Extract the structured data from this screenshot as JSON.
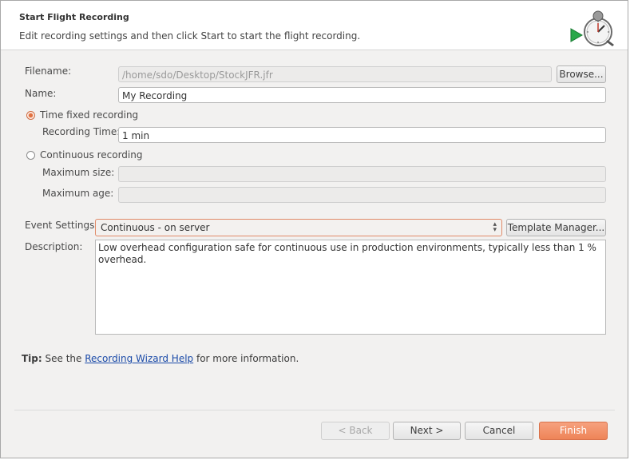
{
  "header": {
    "title": "Start Flight Recording",
    "subtitle": "Edit recording settings and then click Start to start the flight recording."
  },
  "form": {
    "filename_label": "Filename:",
    "filename_value": "/home/sdo/Desktop/StockJFR.jfr",
    "browse_label": "Browse...",
    "name_label": "Name:",
    "name_value": "My Recording",
    "time_fixed_label": "Time fixed recording",
    "time_fixed_checked": true,
    "recording_time_label": "Recording Time:",
    "recording_time_value": "1 min",
    "continuous_label": "Continuous recording",
    "continuous_checked": false,
    "max_size_label": "Maximum size:",
    "max_size_value": "",
    "max_age_label": "Maximum age:",
    "max_age_value": "",
    "event_settings_label": "Event Settings:",
    "event_settings_value": "Continuous - on server",
    "template_manager_label": "Template Manager...",
    "description_label": "Description:",
    "description_value": "Low overhead configuration safe for continuous use in production environments, typically less than 1 % overhead."
  },
  "tip": {
    "prefix": "Tip:",
    "before_link": " See the ",
    "link": "Recording Wizard Help",
    "after_link": " for more information."
  },
  "buttons": {
    "back": "< Back",
    "next": "Next >",
    "cancel": "Cancel",
    "finish": "Finish"
  },
  "colors": {
    "accent": "#ee8458",
    "link": "#1a4aa8"
  }
}
